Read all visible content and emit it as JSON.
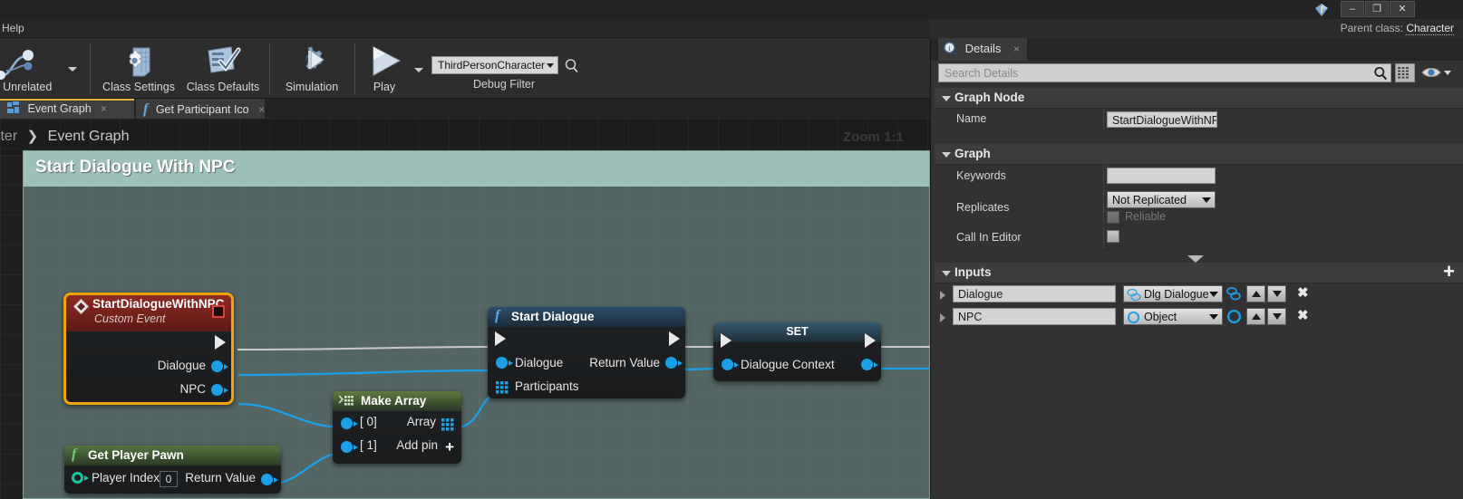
{
  "window": {
    "minimize_label": "–",
    "maximize_label": "❐",
    "close_label": "✕",
    "diamond_icon": "unreal-diamond-icon"
  },
  "menubar": {
    "help_label": "Help"
  },
  "parent_class": {
    "label": "Parent class:",
    "value": "Character"
  },
  "toolbar": {
    "items": [
      {
        "label": "e Unrelated",
        "icon": "find-unrelated-nodes-icon"
      },
      {
        "label": "Class Settings",
        "icon": "class-settings-icon"
      },
      {
        "label": "Class Defaults",
        "icon": "class-defaults-icon"
      },
      {
        "label": "Simulation",
        "icon": "simulation-icon"
      },
      {
        "label": "Play",
        "icon": "play-icon"
      }
    ],
    "debug_filter": {
      "value": "ThirdPersonCharacter",
      "label": "Debug Filter",
      "search_icon": "magnifier-icon"
    }
  },
  "tabs": [
    {
      "label": "Event Graph",
      "icon": "event-graph-icon",
      "close": "×",
      "active": true
    },
    {
      "label": "Get Participant Ico",
      "icon": "function-fx-icon",
      "close": "×",
      "active": false
    }
  ],
  "graph": {
    "breadcrumb": {
      "root": "nCharacter",
      "sep": "❯",
      "current": "Event Graph"
    },
    "zoom_label": "Zoom 1:1",
    "comment": {
      "title": "Start Dialogue With NPC",
      "color": "#9fc0ba"
    },
    "nodes": {
      "event": {
        "title": "StartDialogueWithNPC",
        "subtitle": "Custom Event",
        "icon": "custom-event-diamond-icon",
        "badge": "replication-toggle-icon",
        "pins": [
          {
            "label": "",
            "kind": "exec-out"
          },
          {
            "label": "Dialogue",
            "kind": "data-out"
          },
          {
            "label": "NPC",
            "kind": "data-out"
          }
        ]
      },
      "start_dialogue": {
        "title": "Start Dialogue",
        "icon": "function-fx-icon",
        "inputs": [
          {
            "label": "",
            "kind": "exec-in"
          },
          {
            "label": "Dialogue",
            "kind": "data-in"
          },
          {
            "label": "Participants",
            "kind": "array-in"
          }
        ],
        "outputs": [
          {
            "label": "",
            "kind": "exec-out"
          },
          {
            "label": "Return Value",
            "kind": "data-out"
          }
        ]
      },
      "set": {
        "title": "SET",
        "inputs": [
          {
            "label": "",
            "kind": "exec-in"
          },
          {
            "label": "Dialogue Context",
            "kind": "data-in"
          }
        ],
        "outputs": [
          {
            "label": "",
            "kind": "exec-out"
          },
          {
            "label": "",
            "kind": "data-out"
          }
        ]
      },
      "make_array": {
        "title": "Make Array",
        "icon": "array-grid-icon",
        "inputs": [
          {
            "label": "[ 0]",
            "kind": "data-in"
          },
          {
            "label": "[ 1]",
            "kind": "data-in"
          }
        ],
        "outputs": [
          {
            "label": "Array",
            "kind": "array-out"
          }
        ],
        "add_pin_label": "Add pin",
        "add_pin_icon": "plus-icon"
      },
      "get_player_pawn": {
        "title": "Get Player Pawn",
        "icon": "function-fx-icon",
        "inputs": [
          {
            "label": "Player Index",
            "kind": "int-in",
            "value": "0"
          }
        ],
        "outputs": [
          {
            "label": "Return Value",
            "kind": "data-out"
          }
        ]
      }
    }
  },
  "details": {
    "tab": {
      "label": "Details",
      "icon": "details-info-icon",
      "close": "×"
    },
    "search": {
      "placeholder": "Search Details",
      "icon": "magnifier-icon"
    },
    "grid_button_icon": "column-view-icon",
    "eye_button_icon": "visibility-eye-icon",
    "sections": [
      {
        "title": "Graph Node",
        "rows": [
          {
            "label": "Name",
            "value": "StartDialogueWithNPC",
            "type": "text"
          }
        ]
      },
      {
        "title": "Graph",
        "rows": [
          {
            "label": "Keywords",
            "value": "",
            "type": "text"
          },
          {
            "label": "Replicates",
            "value": "Not Replicated",
            "type": "combo",
            "sub_label": "Reliable",
            "sub_checked": false
          },
          {
            "label": "Call In Editor",
            "value": "",
            "type": "checkbox",
            "checked": false
          }
        ]
      },
      {
        "title": "Inputs",
        "add_icon": "plus-icon",
        "rows": [
          {
            "name": "Dialogue",
            "type_label": "Dlg Dialogue",
            "type_icon": "dialogue-pin-icon",
            "up_icon": "move-up-icon",
            "down_icon": "move-down-icon",
            "remove_icon": "remove-x-icon"
          },
          {
            "name": "NPC",
            "type_label": "Object",
            "type_icon": "object-pin-icon",
            "up_icon": "move-up-icon",
            "down_icon": "move-down-icon",
            "remove_icon": "remove-x-icon"
          }
        ]
      }
    ]
  },
  "colors": {
    "exec_wire": "#c8c8c8",
    "data_wire": "#1ba0e8",
    "selection": "#f0a30a",
    "comment": "#9fc0ba",
    "event_header": "#8e2a22"
  }
}
